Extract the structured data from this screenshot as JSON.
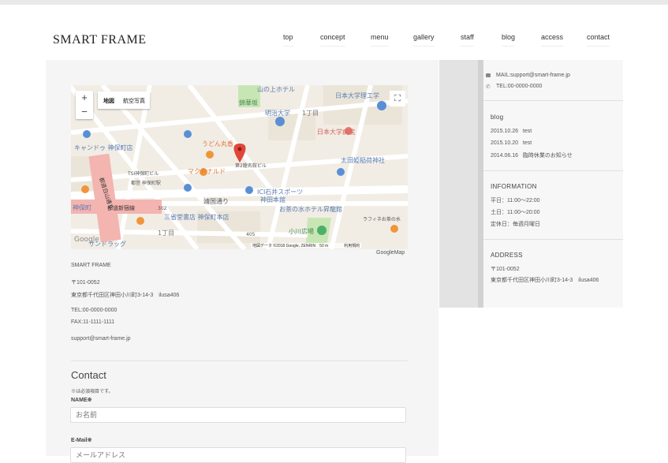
{
  "brand": {
    "logo": "SMART FRAME"
  },
  "nav": [
    "top",
    "concept",
    "menu",
    "gallery",
    "staff",
    "blog",
    "access",
    "contact"
  ],
  "map": {
    "zoom_in": "+",
    "zoom_out": "−",
    "type_map": "地図",
    "type_satellite": "航空写真",
    "fullscreen": "⛶",
    "labels": {
      "hotel": "山の上ホテル",
      "slope": "錦華坂",
      "meiji": "明治大学",
      "chome1": "1丁目",
      "nihon_univ_eng": "日本大学理工学",
      "nihon_hosp": "日本大学病院",
      "udon": "うどん丸香",
      "candle": "キャンドゥ 神保町店",
      "mcd": "マクドナルド",
      "bldg": "第2龍名館ビル",
      "taida": "太田姫稲荷神社",
      "tsi": "TSI神保町ビル",
      "jinbocho_st": "都営 神保町駅",
      "yasukuni": "靖国通り",
      "ici": "ICI石井スポーツ",
      "ici2": "神田本館",
      "hotel2": "お茶の水ホテル昇龍館",
      "route": "都道新宿線",
      "sanseido": "三省堂書店 神保町本店",
      "ogawa": "小川広場",
      "chome1b": "1丁目",
      "jinbo": "神保町",
      "sun": "サンドラッグ",
      "rafine": "ラフィネお茶の水",
      "mita": "都道白山通り",
      "r302": "302",
      "r405": "405"
    },
    "credit": "地図データ ©2018 Google, ZENRIN　50 m　　　　利用規約",
    "google_label": "Google",
    "footer_label": "GoogleMap"
  },
  "info": {
    "company": "SMART FRAME",
    "zip": "〒101-0052",
    "address": "東京都千代田区神田小川町3-14-3　ilusa406",
    "tel": "TEL:00-0000-0000",
    "fax": "FAX:11-1111-1111",
    "email": "support@smart-frame.jp"
  },
  "contact": {
    "title": "Contact",
    "required_note": "※は必須項目です。",
    "name_label": "NAME※",
    "name_placeholder": "お名前",
    "email_label": "E-Mail※",
    "email_placeholder": "メールアドレス"
  },
  "sidebar": {
    "mail": "MAIL:support@smart-frame.jp",
    "tel": "TEL:00-0000-0000",
    "blog_title": "blog",
    "blog_items": [
      {
        "date": "2015.10.26",
        "title": "test"
      },
      {
        "date": "2015.10.20",
        "title": "test"
      },
      {
        "date": "2014.06.16",
        "title": "臨時休業のお知らせ"
      }
    ],
    "information_title": "INFORMATION",
    "hours": [
      "平日：11:00〜22:00",
      "土日：11:00〜20:00",
      "定休日：毎週月曜日"
    ],
    "address_title": "ADDRESS",
    "address_zip": "〒101-0052",
    "address_line": "東京都千代田区神田小川町3-14-3　ilusa406"
  },
  "colors": {
    "map_bg": "#f1ede5",
    "road": "#ffffff",
    "park": "#c8e6b4",
    "route_pink": "#f4b4b0",
    "pin": "#e0463a",
    "poi_blue": "#5a8fd6",
    "poi_orange": "#f0953a"
  }
}
